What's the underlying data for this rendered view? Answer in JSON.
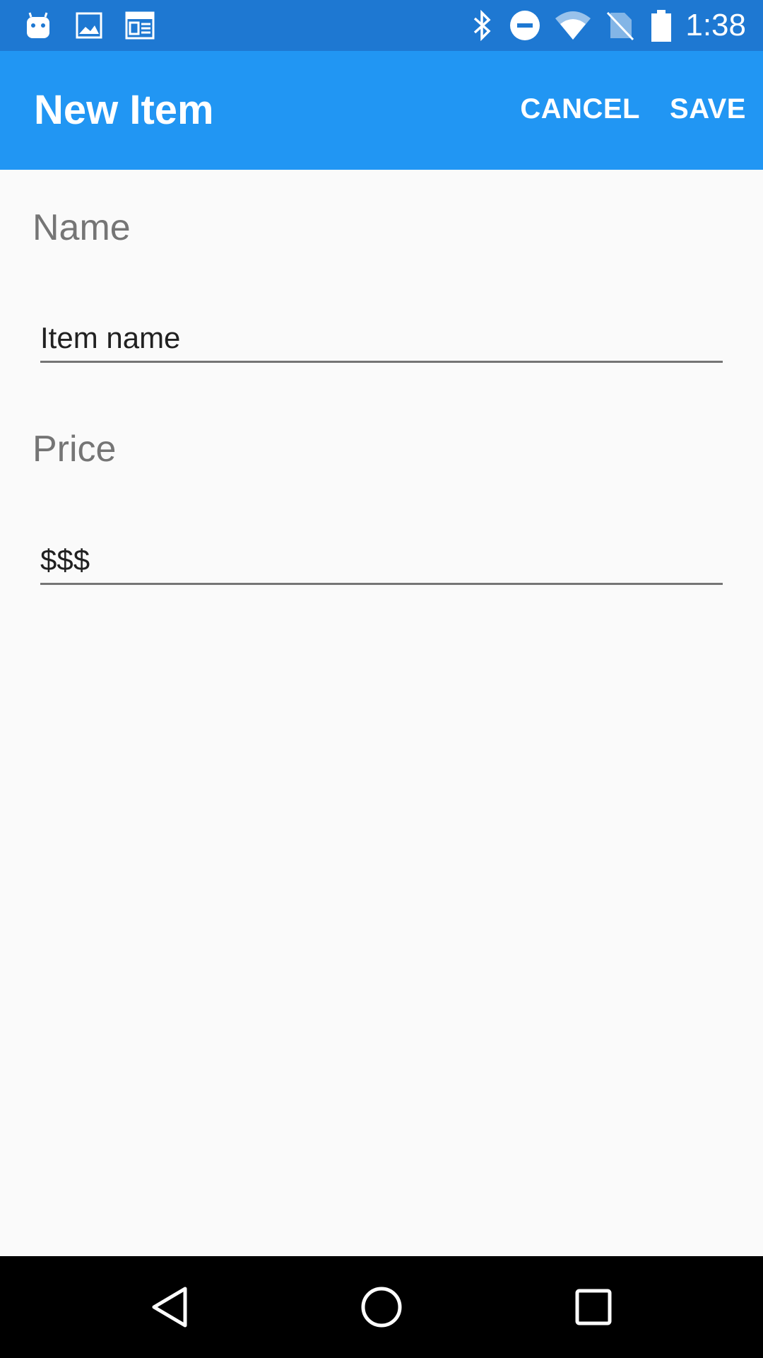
{
  "status_bar": {
    "time": "1:38",
    "left_icons": [
      "android-notification-icon",
      "image-icon",
      "news-icon"
    ],
    "right_icons": [
      "bluetooth-icon",
      "do-not-disturb-icon",
      "wifi-icon",
      "no-sim-icon",
      "battery-icon"
    ]
  },
  "app_bar": {
    "title": "New Item",
    "cancel_label": "CANCEL",
    "save_label": "SAVE"
  },
  "form": {
    "name_label": "Name",
    "name_placeholder": "Item name",
    "price_label": "Price",
    "price_placeholder": "$$$"
  },
  "nav_bar": {
    "buttons": [
      "back-icon",
      "home-icon",
      "recents-icon"
    ]
  },
  "colors": {
    "status_bar": "#1e78d2",
    "app_bar": "#2196f3",
    "background": "#fafafa",
    "label": "#757575",
    "input_text": "#212121",
    "nav_bar": "#000000"
  }
}
